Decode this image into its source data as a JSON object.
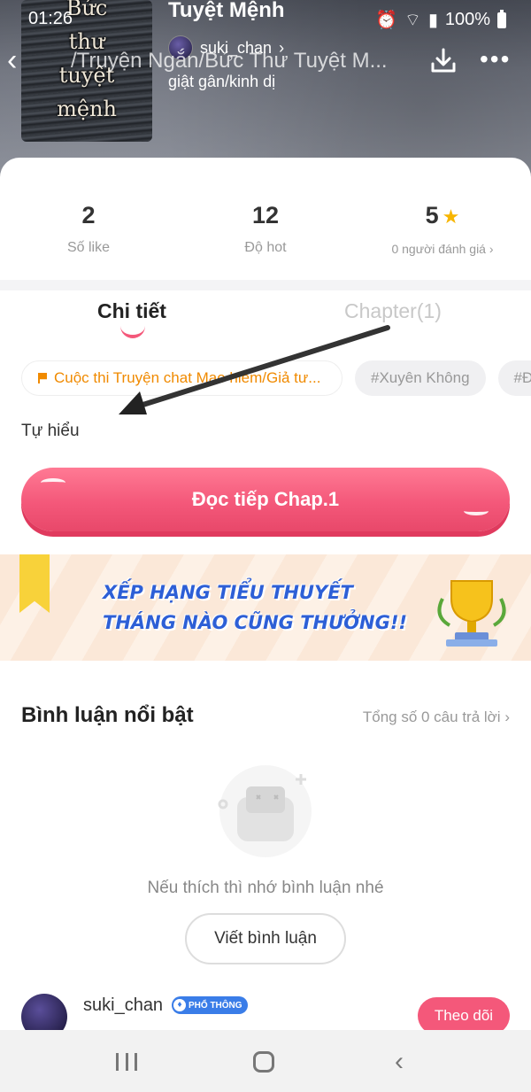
{
  "status_bar": {
    "time": "01:26",
    "battery": "100%"
  },
  "story": {
    "cover_title_lines": [
      "Bức",
      "thư",
      "tuyệt",
      "mệnh"
    ],
    "title": "Tuyệt Mệnh",
    "subtitle": "/Truyện Ngắn/Bức Thư Tuyệt M...",
    "author": "suki_chan",
    "genre": "giật gân/kinh dị"
  },
  "stats": [
    {
      "value": "2",
      "label": "Số like"
    },
    {
      "value": "12",
      "label": "Độ hot"
    },
    {
      "value": "5",
      "label": "0 người đánh giá"
    }
  ],
  "tabs": {
    "detail": "Chi tiết",
    "chapter": "Chapter(1)"
  },
  "tags": [
    "Cuộc thi Truyện chat Mạo hiểm/Giả tư...",
    "#Xuyên Không",
    "#Đa"
  ],
  "description": "Tự hiểu",
  "cta_label": "Đọc tiếp Chap.1",
  "banner": {
    "line1": "XẾP HẠNG TIỂU THUYẾT",
    "line2": "THÁNG NÀO CŨNG THƯỞNG!!"
  },
  "comments": {
    "title": "Bình luận nổi bật",
    "total_link": "Tổng số 0 câu trả lời",
    "empty_text": "Nếu thích thì nhớ bình luận nhé",
    "write_label": "Viết bình luận"
  },
  "author_card": {
    "name": "suki_chan",
    "badge": "PHỔ THÔNG",
    "follow_label": "Theo dõi"
  },
  "colors": {
    "accent": "#f4587a",
    "star": "#f7b500",
    "contest_tag": "#f08a00",
    "badge": "#3a7de8"
  }
}
